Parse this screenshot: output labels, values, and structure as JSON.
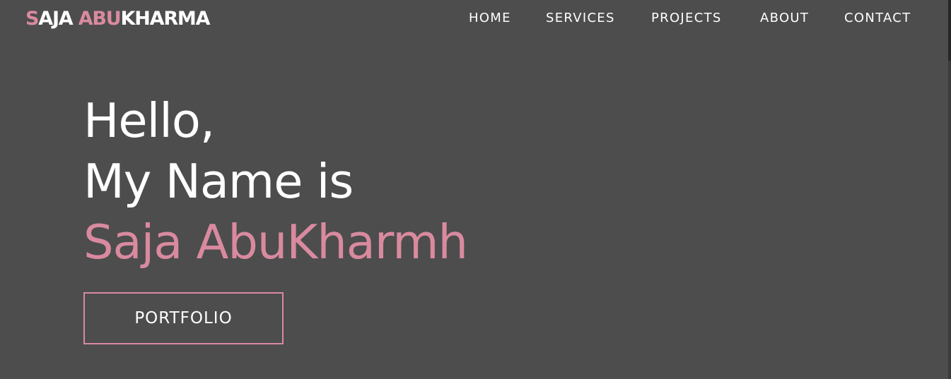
{
  "brand": {
    "parts": [
      {
        "text": "S",
        "accent": true
      },
      {
        "text": "AJA ",
        "accent": false
      },
      {
        "text": "ABU",
        "accent": true
      },
      {
        "text": "KHARMA",
        "accent": false
      }
    ]
  },
  "nav": {
    "items": [
      {
        "label": "HOME"
      },
      {
        "label": "SERVICES"
      },
      {
        "label": "PROJECTS"
      },
      {
        "label": "ABOUT"
      },
      {
        "label": "CONTACT"
      }
    ]
  },
  "hero": {
    "line1": "Hello,",
    "line2": "My Name is",
    "name": "Saja AbuKharmh"
  },
  "cta": {
    "label": "PORTFOLIO"
  },
  "colors": {
    "background": "#4d4d4d",
    "accent": "#d98a9f",
    "text": "#ffffff"
  }
}
